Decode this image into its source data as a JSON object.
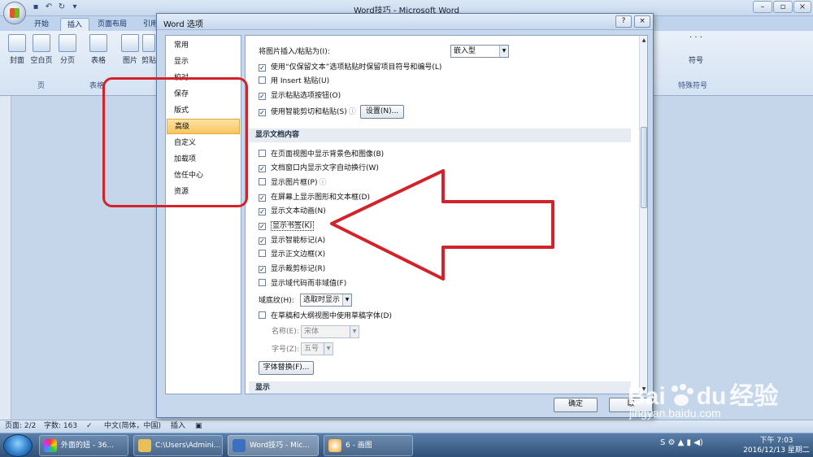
{
  "app": {
    "title": "Word技巧 - Microsoft Word"
  },
  "ribbon": {
    "tabs": [
      "开始",
      "插入",
      "页面布局",
      "引用"
    ],
    "active_tab": "插入",
    "buttons_left": [
      "封面",
      "空白页",
      "分页",
      "表格",
      "图片",
      "剪贴"
    ],
    "group_left": "页",
    "group_left2": "表格",
    "buttons_right": [
      "符号"
    ],
    "group_right": "特殊符号"
  },
  "dialog": {
    "title": "Word 选项",
    "help": "?",
    "close": "×",
    "nav": [
      "常用",
      "显示",
      "校对",
      "保存",
      "版式",
      "高级",
      "自定义",
      "加载项",
      "信任中心",
      "资源"
    ],
    "nav_selected": "高级",
    "paste_as_label": "将图片插入/粘贴为(I):",
    "paste_as_value": "嵌入型",
    "cut_paste_options": [
      {
        "label": "使用“仅保留文本”选项粘贴时保留项目符号和编号(L)",
        "checked": true
      },
      {
        "label": "用 Insert 粘贴(U)",
        "checked": false
      },
      {
        "label": "显示粘贴选项按钮(O)",
        "checked": true
      },
      {
        "label": "使用智能剪切和粘贴(S)",
        "checked": true
      }
    ],
    "settings_button": "设置(N)...",
    "section_show_content": "显示文档内容",
    "show_content_options": [
      {
        "label": "在页面视图中显示背景色和图像(B)",
        "checked": false
      },
      {
        "label": "文档窗口内显示文字自动换行(W)",
        "checked": true
      },
      {
        "label": "显示图片框(P)",
        "checked": false
      },
      {
        "label": "在屏幕上显示图形和文本框(D)",
        "checked": true
      },
      {
        "label": "显示文本动画(N)",
        "checked": true
      },
      {
        "label": "显示书签(K)",
        "checked": true
      },
      {
        "label": "显示智能标记(A)",
        "checked": true
      },
      {
        "label": "显示正文边框(X)",
        "checked": false
      },
      {
        "label": "显示裁剪标记(R)",
        "checked": true
      },
      {
        "label": "显示域代码而非域值(F)",
        "checked": false
      }
    ],
    "field_shading_label": "域底纹(H):",
    "field_shading_value": "选取时显示",
    "draft_font_label": "在草稿和大纲视图中使用草稿字体(D)",
    "draft_font_checked": false,
    "name_label": "名称(E):",
    "name_value": "宋体",
    "size_label": "字号(Z):",
    "size_value": "五号",
    "font_sub_button": "字体替换(F)...",
    "section_display": "显示",
    "ok": "确定",
    "cancel": "取"
  },
  "status": {
    "page": "页面: 2/2",
    "words": "字数: 163",
    "language": "中文(简体，中国)",
    "insert": "插入"
  },
  "taskbar": {
    "items": [
      "外面的妞 - 36...",
      "C:\\Users\\Admini...",
      "Word技巧 - Mic...",
      "6 - 画图"
    ],
    "time": "下午 7:03",
    "date": "2016/12/13 星期二"
  },
  "watermark": {
    "brand": "Bai",
    "brand2": "du",
    "cn": "经验",
    "url": "jingyan.baidu.com"
  },
  "colors": {
    "annotation_red": "#d2222a",
    "selected_nav": "#f8c660",
    "ribbon": "#d4e2f3"
  }
}
